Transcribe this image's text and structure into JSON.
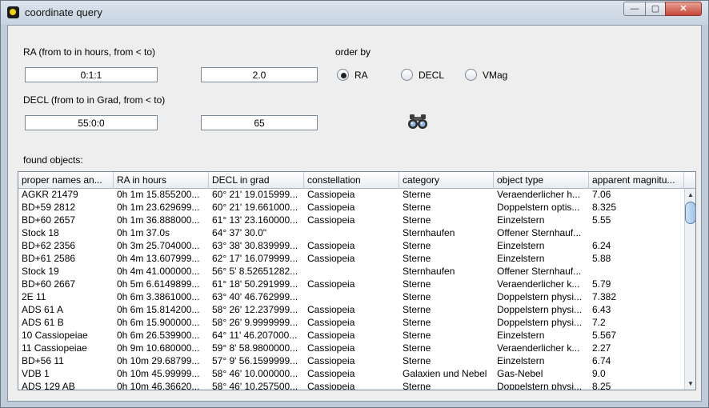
{
  "window": {
    "title": "coordinate query",
    "minimize": "—",
    "maximize": "▢",
    "close": "✕"
  },
  "ra": {
    "label": "RA (from to in hours, from < to)",
    "from": "0:1:1",
    "to": "2.0"
  },
  "decl": {
    "label": "DECL (from to in Grad, from < to)",
    "from": "55:0:0",
    "to": "65"
  },
  "order": {
    "label": "order by",
    "options": [
      {
        "label": "RA",
        "selected": true
      },
      {
        "label": "DECL",
        "selected": false
      },
      {
        "label": "VMag",
        "selected": false
      }
    ]
  },
  "search_icon": "binoculars-icon",
  "found_label": "found objects:",
  "table": {
    "headers": [
      "proper names an...",
      "RA in hours",
      "DECL in grad",
      "constellation",
      "category",
      "object type",
      "apparent magnitu..."
    ],
    "rows": [
      [
        "AGKR 21479",
        "0h 1m 15.855200...",
        "60° 21' 19.015999...",
        "Cassiopeia",
        "Sterne",
        "Veraenderlicher h...",
        "7.06"
      ],
      [
        "BD+59 2812",
        "0h 1m 23.629699...",
        "60° 21' 19.661000...",
        "Cassiopeia",
        "Sterne",
        "Doppelstern optis...",
        "8.325"
      ],
      [
        "BD+60 2657",
        "0h 1m 36.888000...",
        "61° 13' 23.160000...",
        "Cassiopeia",
        "Sterne",
        "Einzelstern",
        "5.55"
      ],
      [
        "Stock 18",
        "0h 1m 37.0s",
        "64° 37' 30.0\"",
        "",
        "Sternhaufen",
        "Offener Sternhauf...",
        ""
      ],
      [
        "BD+62 2356",
        "0h 3m 25.704000...",
        "63° 38' 30.839999...",
        "Cassiopeia",
        "Sterne",
        "Einzelstern",
        "6.24"
      ],
      [
        "BD+61 2586",
        "0h 4m 13.607999...",
        "62° 17' 16.079999...",
        "Cassiopeia",
        "Sterne",
        "Einzelstern",
        "5.88"
      ],
      [
        "Stock 19",
        "0h 4m 41.000000...",
        "56° 5' 8.52651282...",
        "",
        "Sternhaufen",
        "Offener Sternhauf...",
        ""
      ],
      [
        "BD+60 2667",
        "0h 5m 6.6149899...",
        "61° 18' 50.291999...",
        "Cassiopeia",
        "Sterne",
        "Veraenderlicher k...",
        "5.79"
      ],
      [
        "2E 11",
        "0h 6m 3.3861000...",
        "63° 40' 46.762999...",
        "",
        "Sterne",
        "Doppelstern physi...",
        "7.382"
      ],
      [
        "ADS 61 A",
        "0h 6m 15.814200...",
        "58° 26' 12.237999...",
        "Cassiopeia",
        "Sterne",
        "Doppelstern physi...",
        "6.43"
      ],
      [
        "ADS 61 B",
        "0h 6m 15.900000...",
        "58° 26' 9.9999999...",
        "Cassiopeia",
        "Sterne",
        "Doppelstern physi...",
        "7.2"
      ],
      [
        "10 Cassiopeiae",
        "0h 6m 26.539900...",
        "64° 11' 46.207000...",
        "Cassiopeia",
        "Sterne",
        "Einzelstern",
        "5.567"
      ],
      [
        "11 Cassiopeiae",
        "0h 9m 10.680000...",
        "59° 8' 58.9800000...",
        "Cassiopeia",
        "Sterne",
        "Veraenderlicher k...",
        "2.27"
      ],
      [
        "BD+56 11",
        "0h 10m 29.68799...",
        "57° 9' 56.1599999...",
        "Cassiopeia",
        "Sterne",
        "Einzelstern",
        "6.74"
      ],
      [
        "VDB 1",
        "0h 10m 45.99999...",
        "58° 46' 10.000000...",
        "Cassiopeia",
        "Galaxien und Nebel",
        "Gas-Nebel",
        "9.0"
      ],
      [
        "ADS 129 AB",
        "0h 10m 46.36620...",
        "58° 46' 10.257500...",
        "Cassiopeia",
        "Sterne",
        "Doppelstern physi...",
        "8.25"
      ]
    ]
  },
  "scroll_up": "▲",
  "scroll_down": "▼"
}
